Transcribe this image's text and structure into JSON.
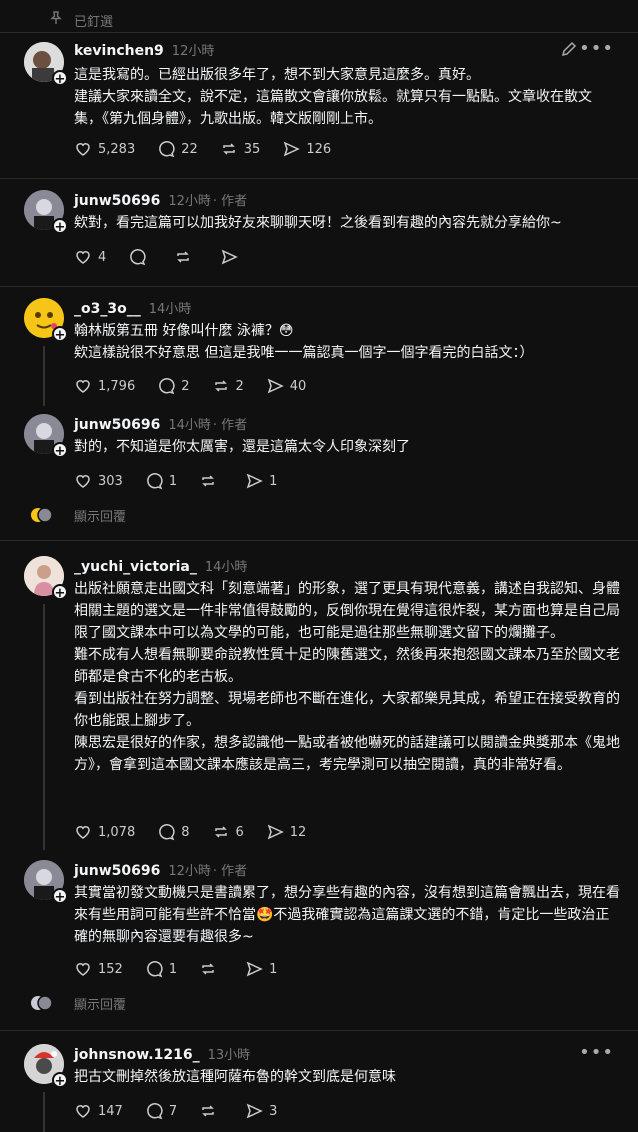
{
  "pinned": {
    "label": "已釘選"
  },
  "posts": [
    {
      "username": "kevinchen9",
      "time": "12小時",
      "body": "這是我寫的。已經出版很多年了，想不到大家意見這麼多。真好。\n建議大家來讀全文，說不定，這篇散文會讓你放鬆。就算只有一點點。文章收在散文集，《第九個身體》，九歌出版。韓文版剛剛上市。",
      "likes": "5,283",
      "comments": "22",
      "reposts": "35",
      "shares": "126"
    },
    {
      "username": "junw50696",
      "time": "12小時",
      "author_tag": "作者",
      "body": "欸對，看完這篇可以加我好友來聊聊天呀！之後看到有趣的內容先就分享給你~",
      "likes": "4",
      "comments": "",
      "reposts": "",
      "shares": ""
    },
    {
      "username": "_o3_3o__",
      "time": "14小時",
      "body": "翰林版第五冊 好像叫什麼 泳褲？😳\n欸這樣說很不好意思 但這是我唯一一篇認真一個字一個字看完的白話文：）",
      "likes": "1,796",
      "comments": "2",
      "reposts": "2",
      "shares": "40"
    },
    {
      "username": "junw50696",
      "time": "14小時",
      "author_tag": "作者",
      "body": "對的，不知道是你太厲害，還是這篇太令人印象深刻了",
      "likes": "303",
      "comments": "1",
      "reposts": "",
      "shares": "1"
    },
    {
      "username": "_yuchi_victoria_",
      "time": "14小時",
      "body": "出版社願意走出國文科「刻意端著」的形象，選了更具有現代意義，講述自我認知、身體相關主題的選文是一件非常值得鼓勵的，反倒你現在覺得這很炸裂，某方面也算是自己局限了國文課本中可以為文學的可能￼，也可能是過往那些無聊選文留下的爛攤子。\n難不成有人想看無聊要命說教性質十足的陳舊選文，然後再來抱怨國文課本乃至於國文老師都是食古不化的老古板￼。\n看到出版社在努力調整、現場老師也不斷在進化，大家都樂見其成，希望正在接受教育的你也能跟上腳步了。\n陳思宏是很好的作家，想多認識他一點或者被他嚇死的話建議可以閱讀金典獎那本《鬼地方》，會拿到這本國文課本應該是高三，考完學測可以抽空閱讀，真的非常好看。",
      "likes": "1,078",
      "comments": "8",
      "reposts": "6",
      "shares": "12"
    },
    {
      "username": "junw50696",
      "time": "12小時",
      "author_tag": "作者",
      "body": "其實當初發文動機只是書讀累了，想分享些有趣的內容，沒有想到這篇會飄出去，現在看來有些用詞可能有些許不恰當🤩不過我確實認為這篇課文選的不錯，肯定比一些政治正確的無聊內容還要有趣很多~",
      "likes": "152",
      "comments": "1",
      "reposts": "",
      "shares": "1"
    },
    {
      "username": "johnsnow.1216_",
      "time": "13小時",
      "body": "把古文刪掉然後放這種阿薩布魯的幹文到底是何意味",
      "likes": "147",
      "comments": "7",
      "reposts": "",
      "shares": "3"
    }
  ],
  "show_replies": [
    "顯示回覆",
    "顯示回覆"
  ],
  "colors": {
    "background": "#101010",
    "text": "#f3f5f7",
    "muted": "#777777",
    "divider": "#2a2a2a"
  }
}
